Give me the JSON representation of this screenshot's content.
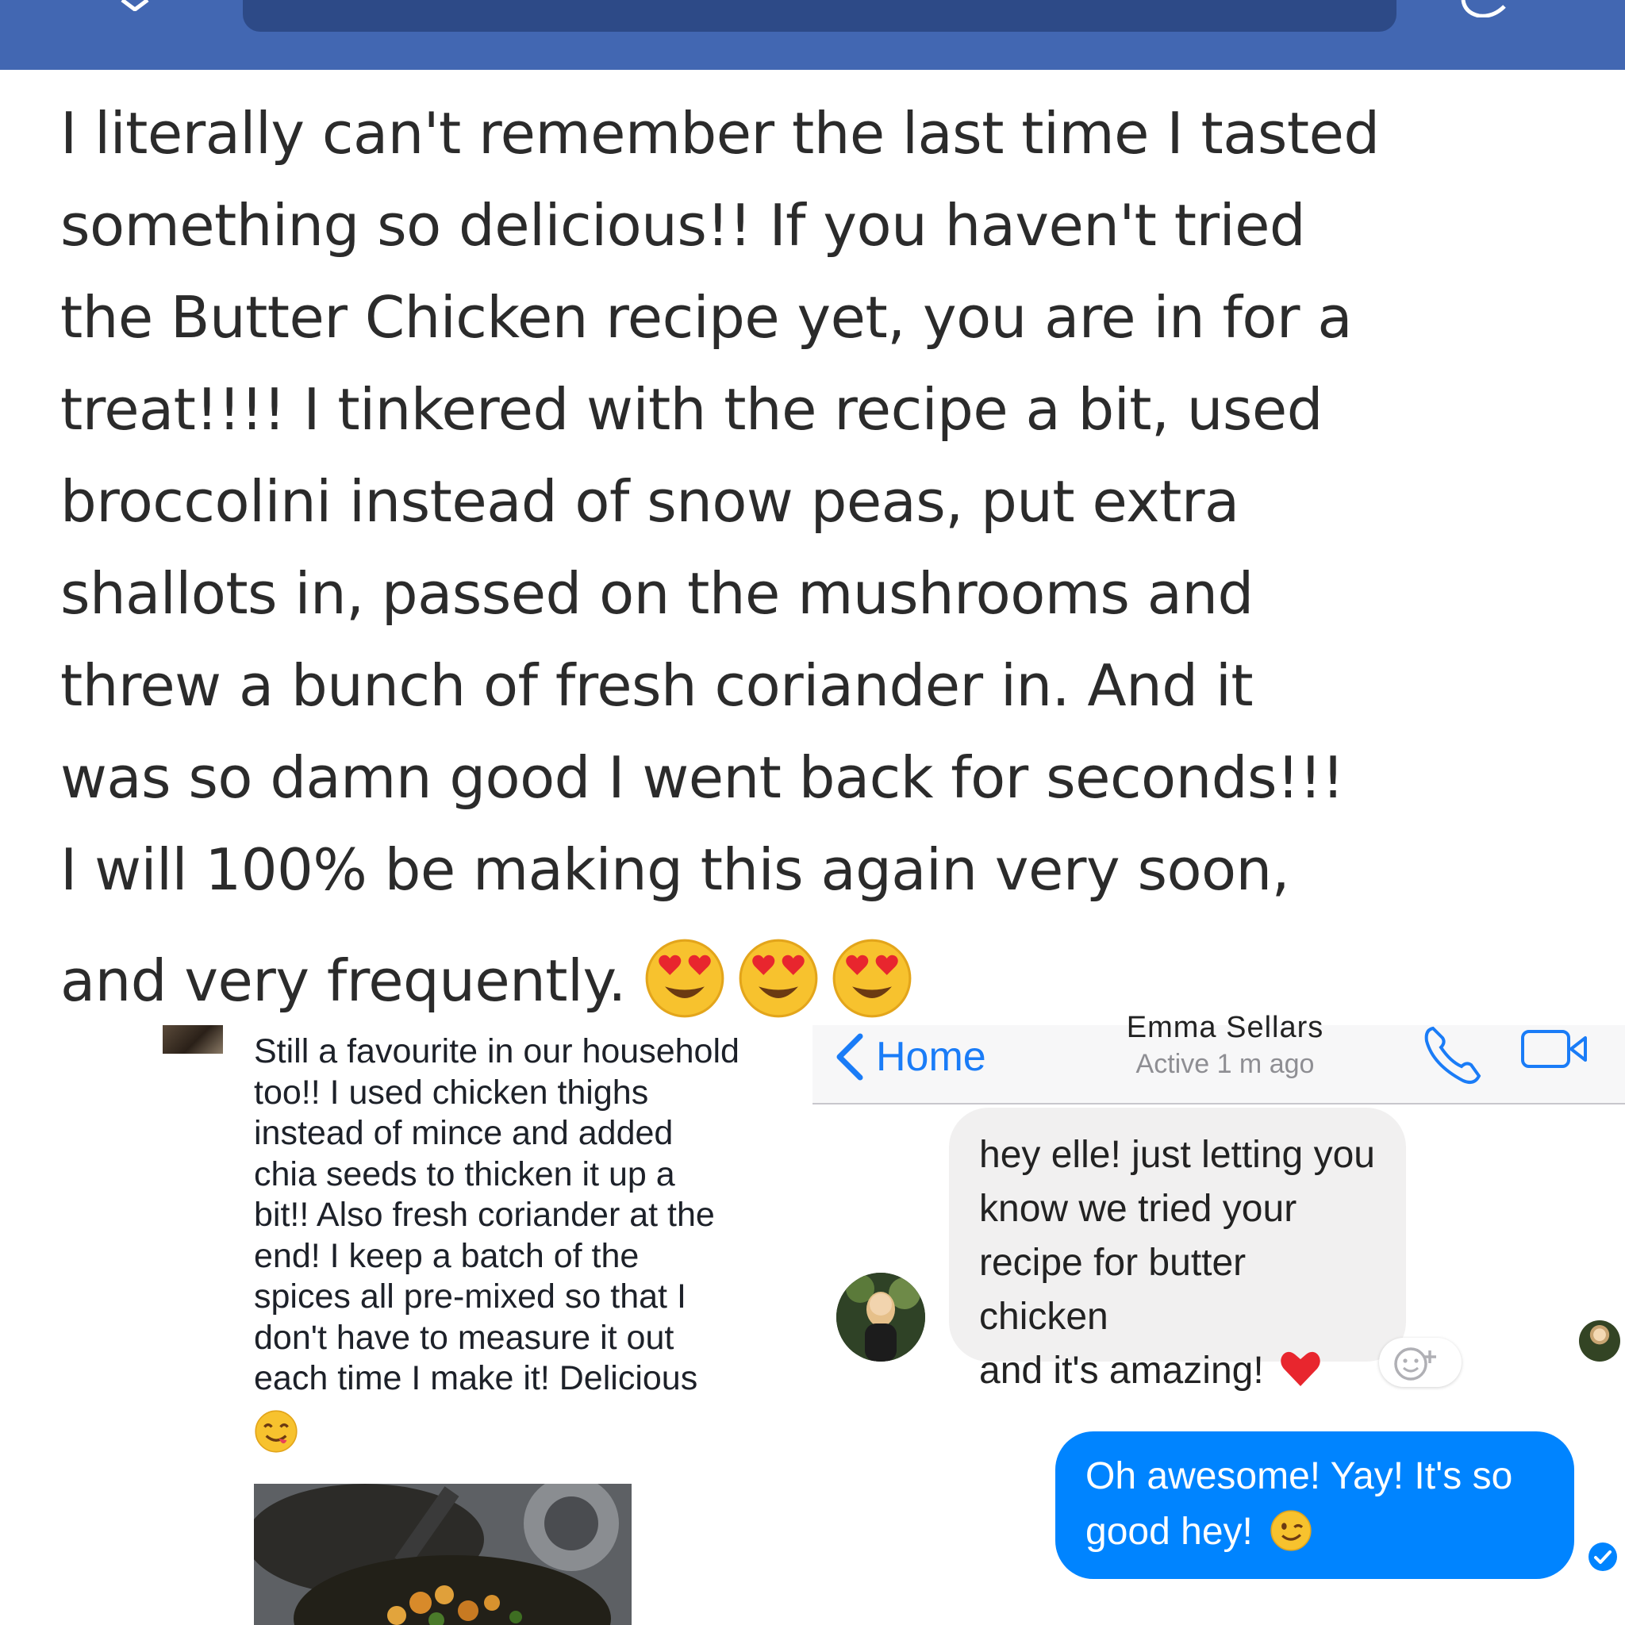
{
  "post": {
    "line1": "I literally can't remember the last time I tasted",
    "line2": "something so delicious!! If you haven't tried",
    "line3": "the Butter Chicken recipe yet, you are in for a",
    "line4": "treat!!!! I tinkered with the recipe a bit, used",
    "line5": "broccolini instead of snow peas, put extra",
    "line6": "shallots in, passed on the mushrooms and",
    "line7": "threw a bunch of fresh coriander in. And it",
    "line8": "was so damn good I went back for seconds!!!",
    "line9": "I will 100% be making this again very soon,",
    "line10": "and very frequently.",
    "emojis": [
      "heart-eyes-emoji",
      "heart-eyes-emoji",
      "heart-eyes-emoji"
    ]
  },
  "comment": {
    "lines": [
      "Still a favourite in our household",
      "too!! I used chicken thighs",
      "instead of mince and added",
      "chia seeds to thicken it up a",
      "bit!!  Also fresh coriander at the",
      "end! I keep a batch of the",
      "spices all pre-mixed so that I",
      "don't have to measure it out",
      "each time I make it! Delicious"
    ],
    "emoji": "yum-face-emoji"
  },
  "messenger": {
    "back_label": "Home",
    "contact_name": "Emma Sellars",
    "active_status": "Active 1 m ago",
    "incoming": {
      "lines": [
        "hey elle! just letting you",
        "know we tried your",
        "recipe for butter chicken",
        "and it's amazing!"
      ],
      "emoji": "red-heart-emoji"
    },
    "outgoing": {
      "lines": [
        "Oh awesome! Yay! It's so",
        "good hey!"
      ],
      "emoji": "wink-emoji"
    }
  },
  "colors": {
    "facebook_blue": "#4267b2",
    "messenger_blue": "#0084ff",
    "ios_blue": "#1a7cf7"
  }
}
